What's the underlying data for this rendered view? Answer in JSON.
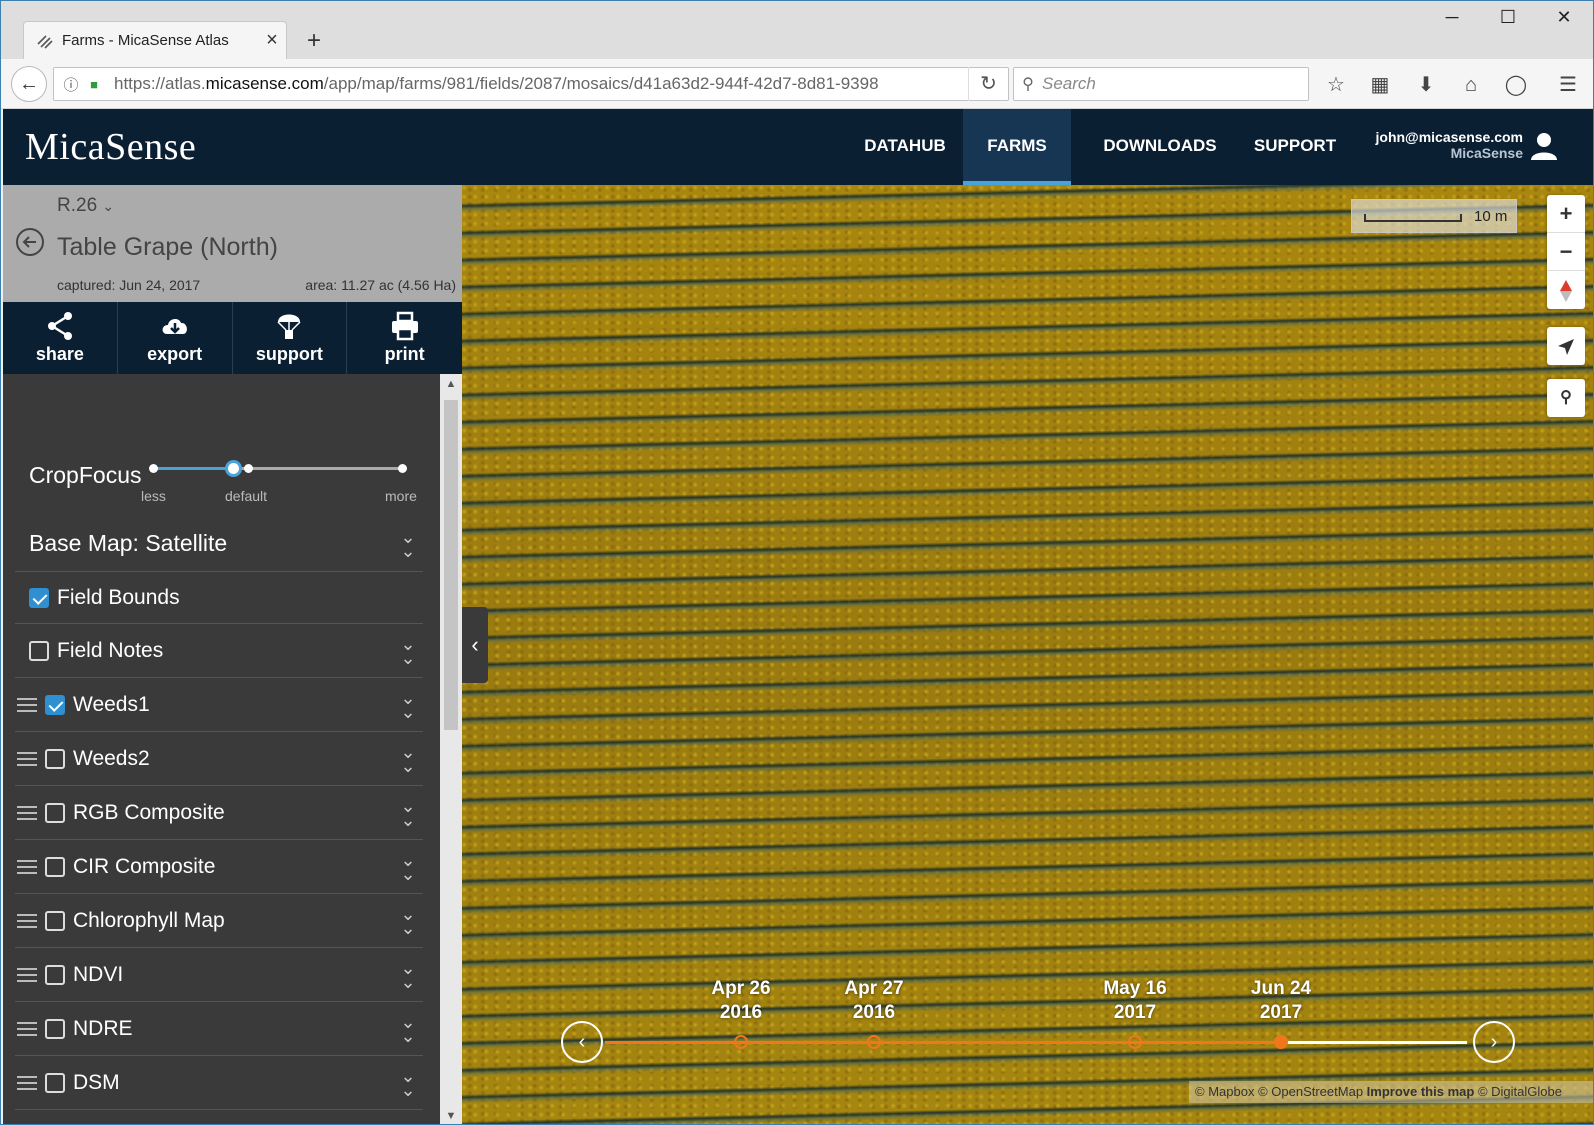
{
  "browser": {
    "tab_title": "Farms - MicaSense Atlas",
    "new_tab": "+",
    "url_prefix": "https://atlas.",
    "url_domain": "micasense.com",
    "url_path": "/app/map/farms/981/fields/2087/mosaics/d41a63d2-944f-42d7-8d81-9398",
    "search_placeholder": "Search",
    "window_controls": {
      "minimize": "─",
      "maximize": "☐",
      "close": "✕"
    }
  },
  "app": {
    "logo": "MicaSense",
    "nav": [
      {
        "label": "DATAHUB"
      },
      {
        "label": "FARMS",
        "active": true
      },
      {
        "label": "DOWNLOADS"
      },
      {
        "label": "SUPPORT"
      }
    ],
    "user": {
      "email": "john@micasense.com",
      "org": "MicaSense"
    }
  },
  "field": {
    "selector": "R.26",
    "name": "Table Grape (North)",
    "captured": "captured: Jun 24, 2017",
    "area": "area: 11.27 ac (4.56 Ha)"
  },
  "actions": [
    {
      "label": "share",
      "icon": "share-icon"
    },
    {
      "label": "export",
      "icon": "cloud-download-icon"
    },
    {
      "label": "support",
      "icon": "parachute-icon"
    },
    {
      "label": "print",
      "icon": "printer-icon"
    }
  ],
  "cropfocus": {
    "label": "CropFocus",
    "ticks": {
      "less": "less",
      "default": "default",
      "more": "more"
    },
    "value": 0.32
  },
  "layers": {
    "base_map": "Base Map: Satellite",
    "items": [
      {
        "label": "Field Bounds",
        "checked": true,
        "draggable": false,
        "expandable": false
      },
      {
        "label": "Field Notes",
        "checked": false,
        "draggable": false,
        "expandable": true
      },
      {
        "label": "Weeds1",
        "checked": true,
        "draggable": true,
        "expandable": true
      },
      {
        "label": "Weeds2",
        "checked": false,
        "draggable": true,
        "expandable": true
      },
      {
        "label": "RGB Composite",
        "checked": false,
        "draggable": true,
        "expandable": true
      },
      {
        "label": "CIR Composite",
        "checked": false,
        "draggable": true,
        "expandable": true
      },
      {
        "label": "Chlorophyll Map",
        "checked": false,
        "draggable": true,
        "expandable": true
      },
      {
        "label": "NDVI",
        "checked": false,
        "draggable": true,
        "expandable": true
      },
      {
        "label": "NDRE",
        "checked": false,
        "draggable": true,
        "expandable": true
      },
      {
        "label": "DSM",
        "checked": false,
        "draggable": true,
        "expandable": true
      }
    ]
  },
  "map": {
    "scale_label": "10 m",
    "controls": {
      "zoom_in": "+",
      "zoom_out": "−"
    },
    "attribution": {
      "mapbox": "© Mapbox",
      "osm": "© OpenStreetMap",
      "improve": "Improve this map",
      "digitalglobe": "© DigitalGlobe"
    }
  },
  "timeline": {
    "dates": [
      {
        "month_day": "Apr 26",
        "year": "2016"
      },
      {
        "month_day": "Apr 27",
        "year": "2016"
      },
      {
        "month_day": "May 16",
        "year": "2017"
      },
      {
        "month_day": "Jun 24",
        "year": "2017",
        "current": true
      }
    ]
  },
  "colors": {
    "header": "#0b1f33",
    "accent": "#4aa3d8",
    "timeline": "#f0771b",
    "checkbox": "#2f8fd0"
  }
}
